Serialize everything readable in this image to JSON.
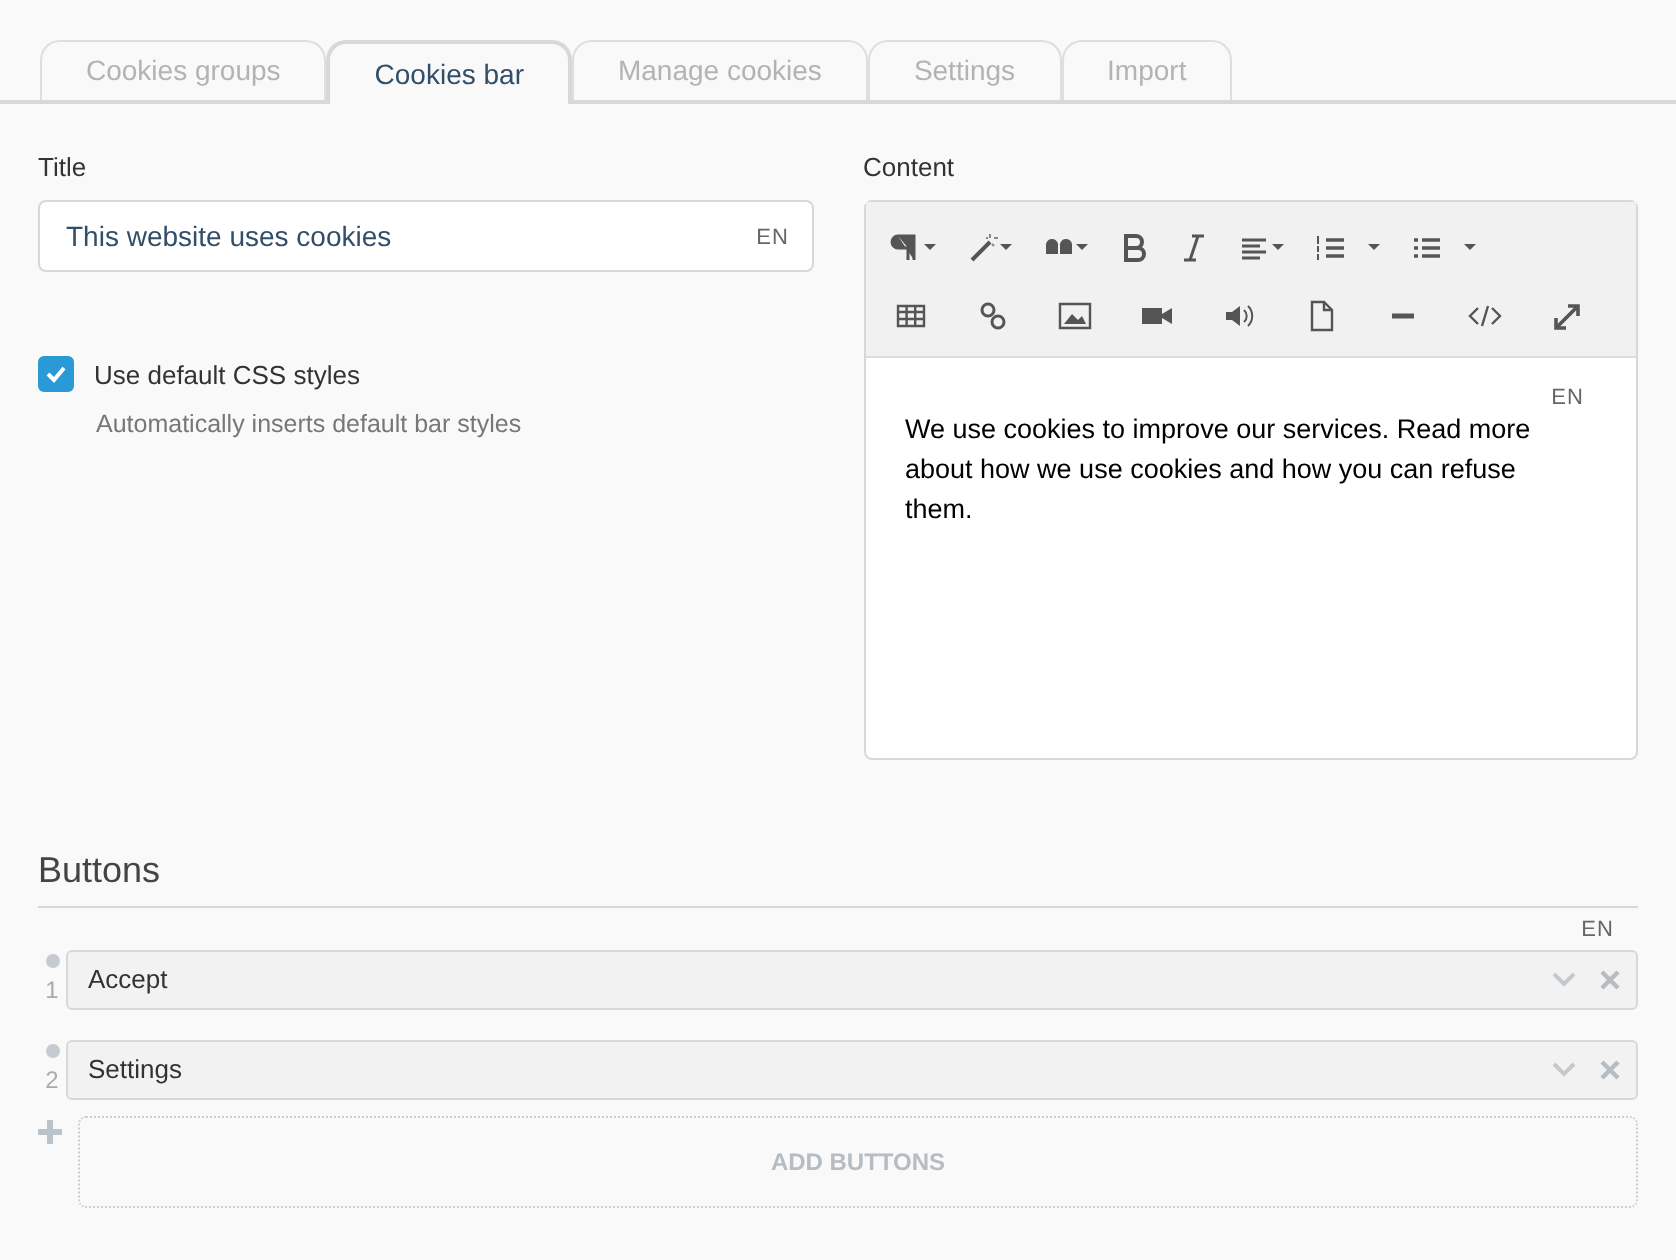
{
  "tabs": [
    {
      "label": "Cookies groups",
      "selected": false
    },
    {
      "label": "Cookies bar",
      "selected": true
    },
    {
      "label": "Manage cookies",
      "selected": false
    },
    {
      "label": "Settings",
      "selected": false
    },
    {
      "label": "Import",
      "selected": false
    }
  ],
  "title_field": {
    "label": "Title",
    "value": "This website uses cookies",
    "lang": "EN"
  },
  "default_css": {
    "label": "Use default CSS styles",
    "help": "Automatically inserts default bar styles",
    "checked": true
  },
  "content": {
    "label": "Content",
    "lang": "EN",
    "text": "We use cookies to improve our services. Read more about how we use cookies and how you can refuse them."
  },
  "buttons": {
    "heading": "Buttons",
    "lang": "EN",
    "items": [
      {
        "number": "1",
        "value": "Accept"
      },
      {
        "number": "2",
        "value": "Settings"
      }
    ],
    "add_label": "ADD BUTTONS"
  }
}
